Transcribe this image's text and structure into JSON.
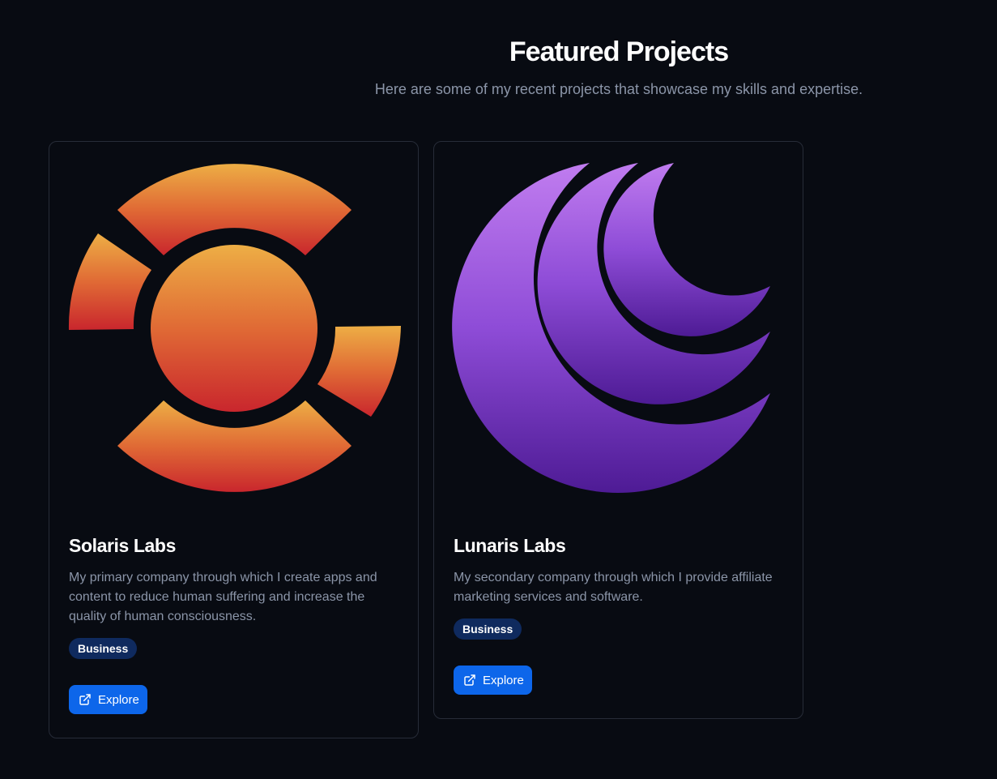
{
  "header": {
    "title": "Featured Projects",
    "subtitle": "Here are some of my recent projects that showcase my skills and expertise."
  },
  "projects": [
    {
      "name": "Solaris Labs",
      "description": "My primary company through which I create apps and content to reduce human suffering and increase the quality of human consciousness.",
      "tag": "Business",
      "button_label": "Explore",
      "logo_icon": "solaris-sun-logo",
      "gradient": [
        "#edae45",
        "#e06a35",
        "#c9262d"
      ]
    },
    {
      "name": "Lunaris Labs",
      "description": "My secondary company through which I provide affiliate marketing services and software.",
      "tag": "Business",
      "button_label": "Explore",
      "logo_icon": "lunaris-moon-logo",
      "gradient": [
        "#c07cef",
        "#8e4cd7",
        "#4e1b95"
      ]
    }
  ],
  "colors": {
    "background": "#080b12",
    "card_border": "#272c38",
    "tag_background": "#0f2a5e",
    "button_background": "#0d66ea",
    "muted_text": "#8b95a8"
  }
}
